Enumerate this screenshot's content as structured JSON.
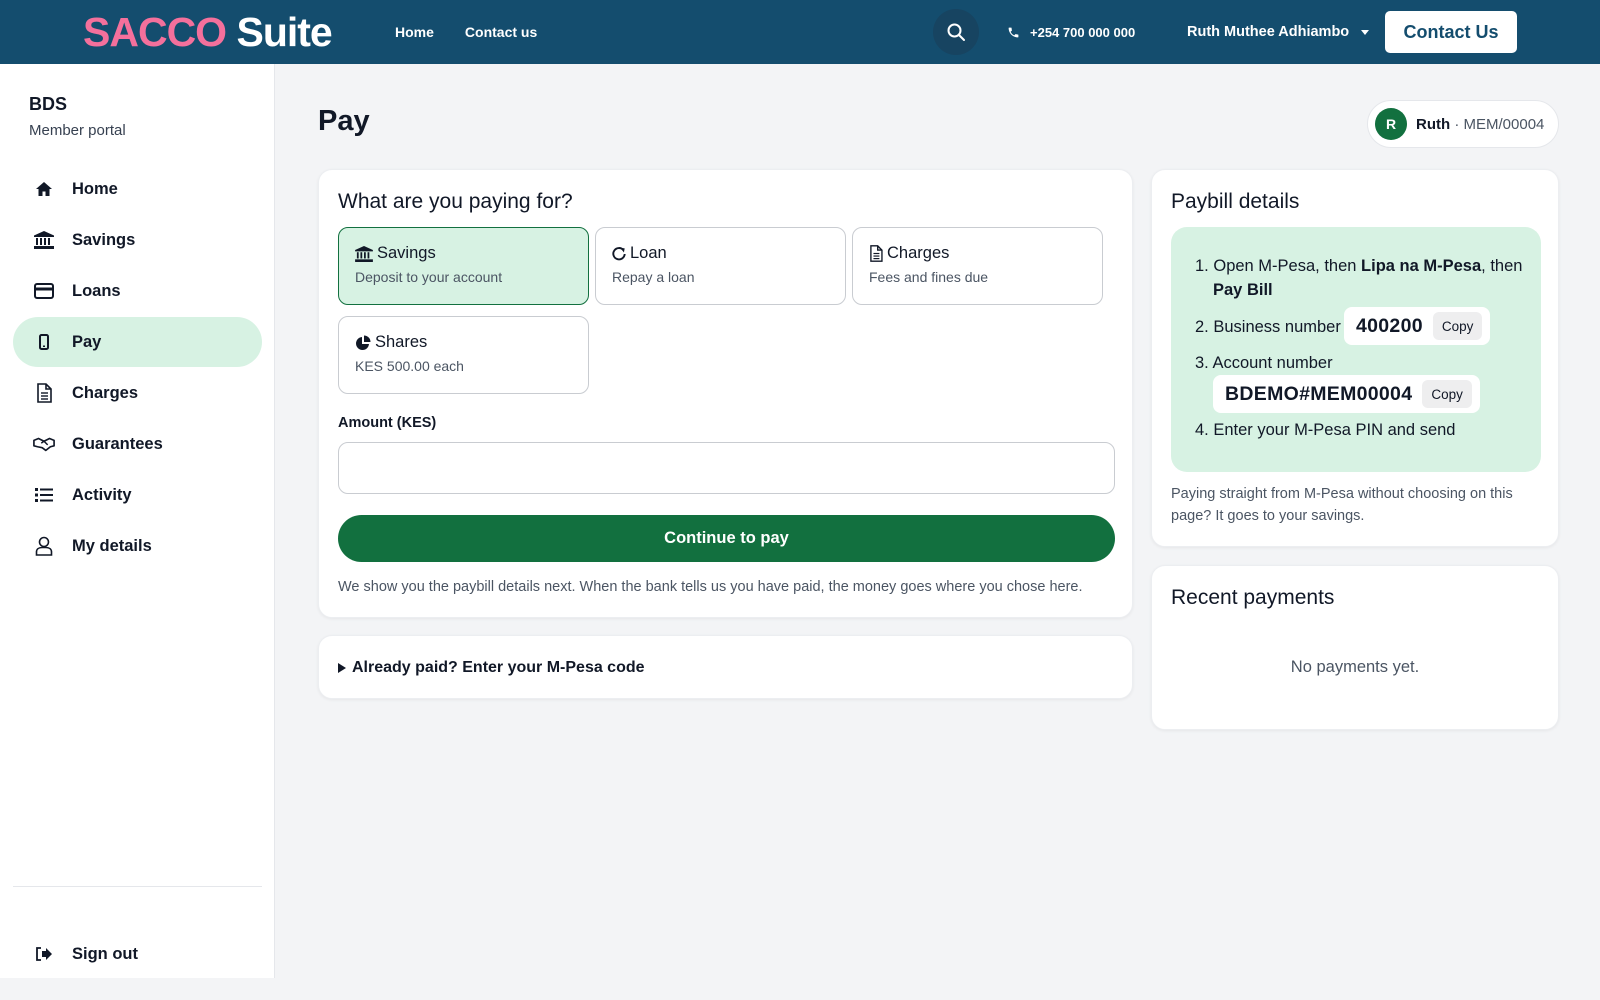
{
  "topbar": {
    "logo_part1": "SACCO",
    "logo_part2": "Suite",
    "nav": [
      "Home",
      "Contact us"
    ],
    "phone": "+254 700 000 000",
    "user_name": "Ruth Muthee Adhiambo",
    "contact_button": "Contact Us",
    "icons": {
      "search": "search-icon",
      "phone": "phone-icon",
      "menu_caret": "chevron-down-icon"
    }
  },
  "sidebar": {
    "org_name": "BDS",
    "org_sub": "Member portal",
    "items": [
      {
        "label": "Home",
        "icon": "home-icon",
        "active": false
      },
      {
        "label": "Savings",
        "icon": "bank-icon",
        "active": false
      },
      {
        "label": "Loans",
        "icon": "credit-card-icon",
        "active": false
      },
      {
        "label": "Pay",
        "icon": "mobile-phone-icon",
        "active": true
      },
      {
        "label": "Charges",
        "icon": "document-icon",
        "active": false
      },
      {
        "label": "Guarantees",
        "icon": "handshake-icon",
        "active": false
      },
      {
        "label": "Activity",
        "icon": "list-icon",
        "active": false
      },
      {
        "label": "My details",
        "icon": "user-icon",
        "active": false
      }
    ],
    "signout": {
      "label": "Sign out",
      "icon": "sign-out-icon"
    }
  },
  "page": {
    "title": "Pay",
    "member_chip": {
      "avatar_letter": "R",
      "name": "Ruth",
      "separator": " · ",
      "member_no": "MEM/00004"
    }
  },
  "pay_form": {
    "heading": "What are you paying for?",
    "options": [
      {
        "title": "Savings",
        "desc": "Deposit to your account",
        "icon": "bank-icon",
        "selected": true
      },
      {
        "title": "Loan",
        "desc": "Repay a loan",
        "icon": "refresh-icon",
        "selected": false
      },
      {
        "title": "Charges",
        "desc": "Fees and fines due",
        "icon": "document-icon",
        "selected": false
      },
      {
        "title": "Shares",
        "desc": "KES 500.00 each",
        "icon": "pie-chart-icon",
        "selected": false
      }
    ],
    "amount_label": "Amount (KES)",
    "amount_value": "",
    "continue_button": "Continue to pay",
    "note": "We show you the paybill details next. When the bank tells us you have paid, the money goes where you chose here."
  },
  "already_paid": {
    "label": "Already paid? Enter your M-Pesa code"
  },
  "paybill": {
    "heading": "Paybill details",
    "step1_prefix": "Open M-Pesa, then ",
    "step1_bold1": "Lipa na M-Pesa",
    "step1_mid": ", then",
    "step1_bold2": "Pay Bill",
    "step2_label": "Business number",
    "business_number": "400200",
    "step3_label": "Account number",
    "account_number": "BDEMO#MEM00004",
    "copy_label": "Copy",
    "step4_label": "Enter your M-Pesa PIN and send",
    "note": "Paying straight from M-Pesa without choosing on this page? It goes to your savings.",
    "step_numbers": [
      "1.",
      "2.",
      "3.",
      "4."
    ]
  },
  "recent": {
    "heading": "Recent payments",
    "empty": "No payments yet."
  },
  "colors": {
    "topbar": "#144d6e",
    "logo_pink": "#f4709c",
    "primary_green": "#12703f",
    "light_green": "#d7f2e3"
  }
}
